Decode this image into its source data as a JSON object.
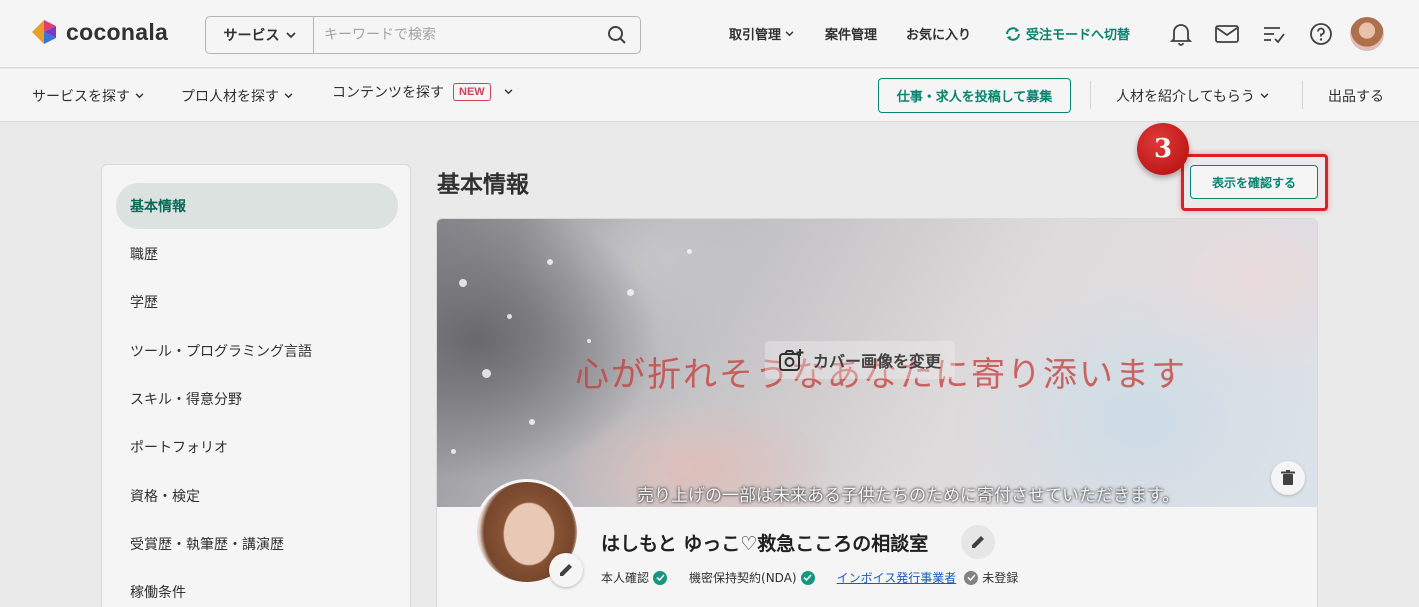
{
  "header": {
    "logo_text": "coconala",
    "search": {
      "category": "サービス",
      "placeholder": "キーワードで検索"
    },
    "nav": {
      "transactions": "取引管理",
      "projects": "案件管理",
      "favorites": "お気に入り",
      "mode_switch": "受注モードへ切替"
    },
    "icons": [
      "bell-icon",
      "mail-icon",
      "checklist-icon",
      "help-icon"
    ]
  },
  "subnav": {
    "find_services": "サービスを探す",
    "find_pros": "プロ人材を探す",
    "find_contents": "コンテンツを探す",
    "new_badge": "NEW",
    "post_job": "仕事・求人を投稿して募集",
    "referral": "人材を紹介してもらう",
    "sell": "出品する"
  },
  "sidebar": {
    "items": [
      {
        "label": "基本情報",
        "active": true
      },
      {
        "label": "職歴"
      },
      {
        "label": "学歴"
      },
      {
        "label": "ツール・プログラミング言語"
      },
      {
        "label": "スキル・得意分野"
      },
      {
        "label": "ポートフォリオ"
      },
      {
        "label": "資格・検定"
      },
      {
        "label": "受賞歴・執筆歴・講演歴"
      },
      {
        "label": "稼働条件"
      }
    ]
  },
  "main": {
    "title": "基本情報",
    "preview_button": "表示を確認する",
    "step_number": "3",
    "cover": {
      "headline": "心が折れそうなあなたに寄り添います",
      "change_label": "カバー画像を変更",
      "subline": "売り上げの一部は未来ある子供たちのために寄付させていただきます。"
    },
    "profile": {
      "name": "はしもと ゆっこ♡救急こころの相談室",
      "identity_verified": "本人確認",
      "nda": "機密保持契約(NDA)",
      "invoice_label": "インボイス発行事業者",
      "invoice_status": "未登録"
    }
  },
  "colors": {
    "accent": "#0a8a75",
    "highlight": "#e3232b",
    "link": "#1c5fc9"
  }
}
